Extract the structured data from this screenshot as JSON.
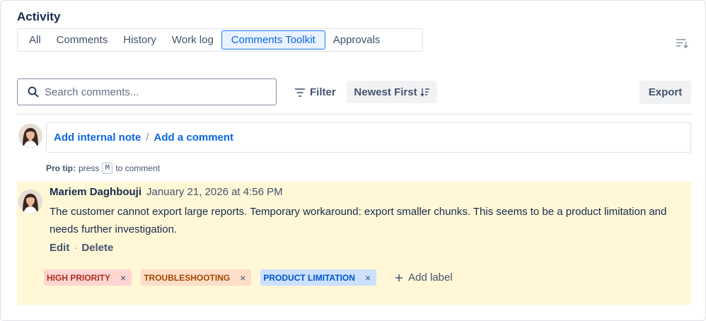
{
  "activity": {
    "title": "Activity",
    "tabs": [
      {
        "label": "All",
        "active": false
      },
      {
        "label": "Comments",
        "active": false
      },
      {
        "label": "History",
        "active": false
      },
      {
        "label": "Work log",
        "active": false
      },
      {
        "label": "Comments Toolkit",
        "active": true
      },
      {
        "label": "Approvals",
        "active": false
      }
    ]
  },
  "toolbar": {
    "search_placeholder": "Search comments...",
    "search_value": "",
    "filter_label": "Filter",
    "sort_label": "Newest First",
    "export_label": "Export"
  },
  "composer": {
    "internal_note_label": "Add internal note",
    "separator": "/",
    "add_comment_label": "Add a comment",
    "protip_prefix": "Pro tip:",
    "protip_press": "press",
    "protip_key": "M",
    "protip_suffix": "to comment"
  },
  "comment": {
    "author": "Mariem Daghbouji",
    "timestamp": "January 21, 2026 at 4:56 PM",
    "text": "The customer cannot export large reports. Temporary workaround: export smaller chunks. This seems to be a product limitation and needs further investigation.",
    "edit_label": "Edit",
    "action_separator": "·",
    "delete_label": "Delete",
    "highlight_color": "#fff7d6",
    "labels": [
      {
        "text": "HIGH PRIORITY",
        "color": "red"
      },
      {
        "text": "TROUBLESHOOTING",
        "color": "orange"
      },
      {
        "text": "PRODUCT LIMITATION",
        "color": "blue"
      }
    ],
    "remove_glyph": "×",
    "add_label": "Add label"
  },
  "colors": {
    "accent": "#0c66e4",
    "label_red_bg": "#ffd5d2",
    "label_orange_bg": "#fedec8",
    "label_blue_bg": "#cce0ff"
  }
}
